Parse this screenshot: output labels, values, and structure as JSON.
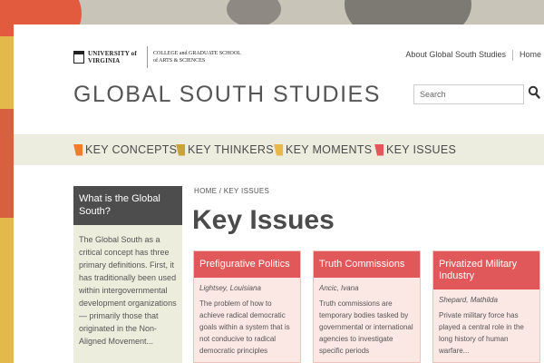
{
  "header": {
    "logo_university": "UNIVERSITY of VIRGINIA",
    "logo_school": "COLLEGE and GRADUATE SCHOOL of ARTS & SCIENCES",
    "links": [
      "About Global South Studies",
      "Home"
    ],
    "site_title": "GLOBAL SOUTH STUDIES",
    "search_placeholder": "Search"
  },
  "nav": {
    "items": [
      {
        "label": "KEY CONCEPTS",
        "color": "#ef7d2b"
      },
      {
        "label": "KEY THINKERS",
        "color": "#c9a23a"
      },
      {
        "label": "KEY MOMENTS",
        "color": "#e8b84a"
      },
      {
        "label": "KEY ISSUES",
        "color": "#e0585a"
      }
    ]
  },
  "sidebar": {
    "title": "What is the Global South?",
    "text": "The Global South as a critical concept has three primary definitions. First, it has traditionally been used within intergovernmental development organizations — primarily those that originated in the Non-Aligned Movement..."
  },
  "breadcrumb": "HOME / KEY ISSUES",
  "page_title": "Key Issues",
  "cards": [
    {
      "title": "Prefigurative Politics",
      "author": "Lightsey, Louisiana",
      "text": "The problem of how to achieve radical democratic goals within a system that is not conducive to radical democratic principles"
    },
    {
      "title": "Truth Commissions",
      "author": "Ancic, Ivana",
      "text": "Truth commissions are temporary bodies tasked by governmental or international agencies to investigate specific periods"
    },
    {
      "title": "Privatized Military Industry",
      "author": "Shepard, Mathilda",
      "text": "Private military force has played a central role in the long history of human warfare..."
    }
  ]
}
